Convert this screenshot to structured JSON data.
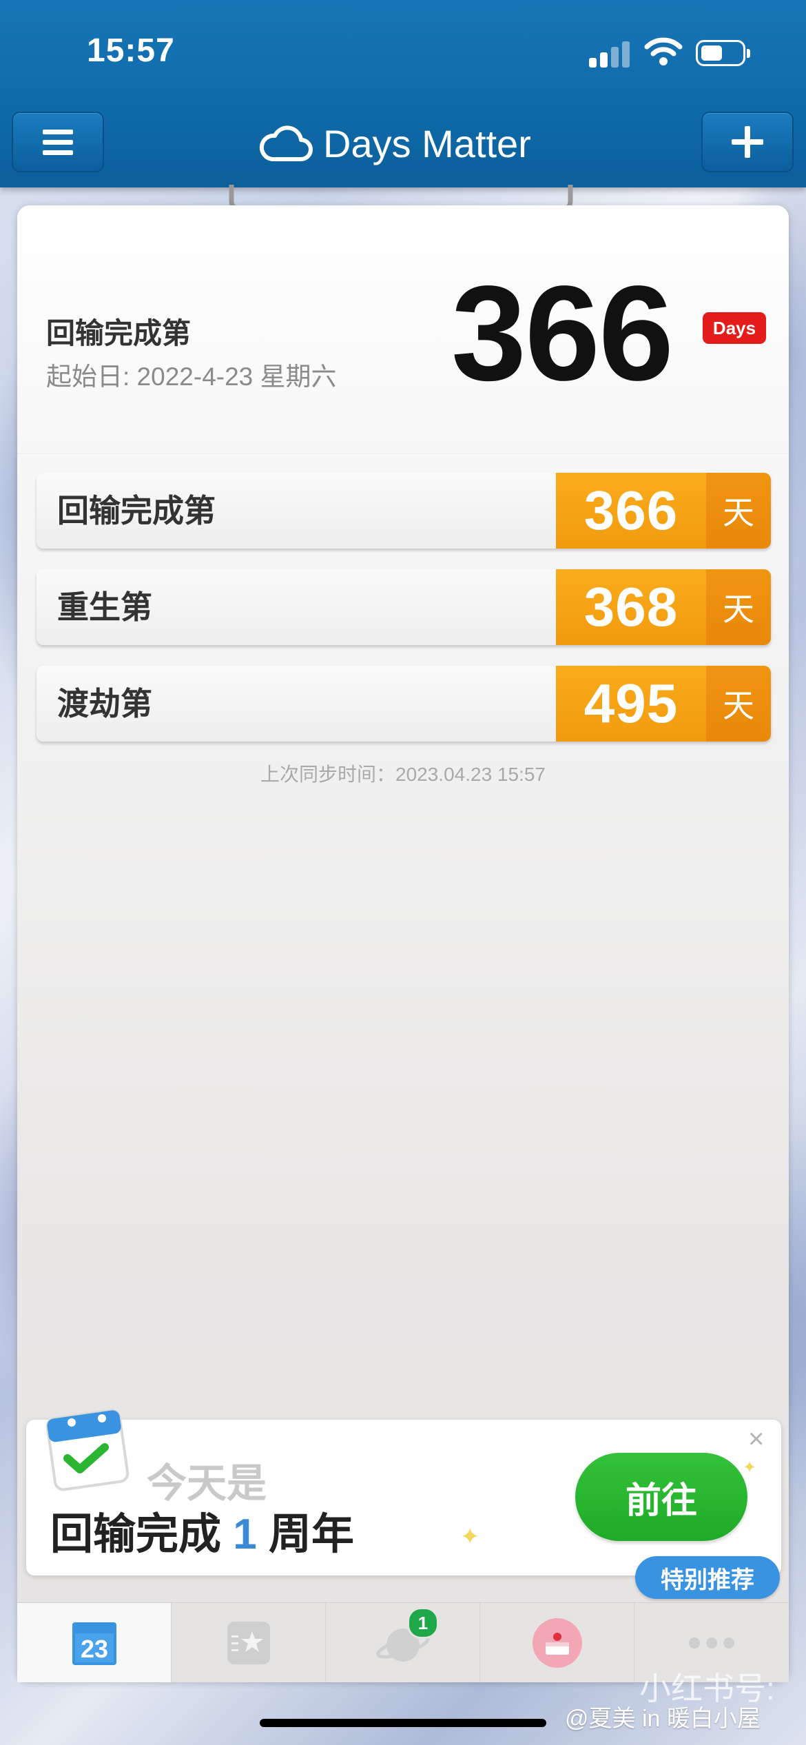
{
  "status_bar": {
    "time": "15:57"
  },
  "header": {
    "title": "Days Matter",
    "menu_icon": "menu-icon",
    "add_icon": "plus-icon",
    "title_icon": "cloud-icon"
  },
  "hero": {
    "title": "回输完成第",
    "start_date": "起始日: 2022-4-23 星期六",
    "count": "366",
    "badge": "Days"
  },
  "events": [
    {
      "label": "回输完成第",
      "count": "366",
      "unit": "天"
    },
    {
      "label": "重生第",
      "count": "368",
      "unit": "天"
    },
    {
      "label": "渡劫第",
      "count": "495",
      "unit": "天"
    }
  ],
  "sync_text": "上次同步时间：2023.04.23 15:57",
  "banner": {
    "kicker": "今天是",
    "main_prefix": "回输完成",
    "main_number": "1",
    "main_suffix": "周年",
    "go_button": "前往",
    "close": "×",
    "recommend_badge": "特别推荐"
  },
  "tabbar": {
    "tabs": [
      {
        "icon": "calendar-icon",
        "label": "23"
      },
      {
        "icon": "star-list-icon"
      },
      {
        "icon": "planet-icon",
        "badge": "1"
      },
      {
        "icon": "cake-icon"
      },
      {
        "icon": "more-icon"
      }
    ]
  },
  "watermark": {
    "line1": "小红书号:",
    "line2": "@夏美 in 暖白小屋"
  },
  "colors": {
    "header": "#1170b0",
    "orange": "#f5a216",
    "green": "#2bb532",
    "red_badge": "#e41b1b",
    "blue": "#3a93e0"
  }
}
